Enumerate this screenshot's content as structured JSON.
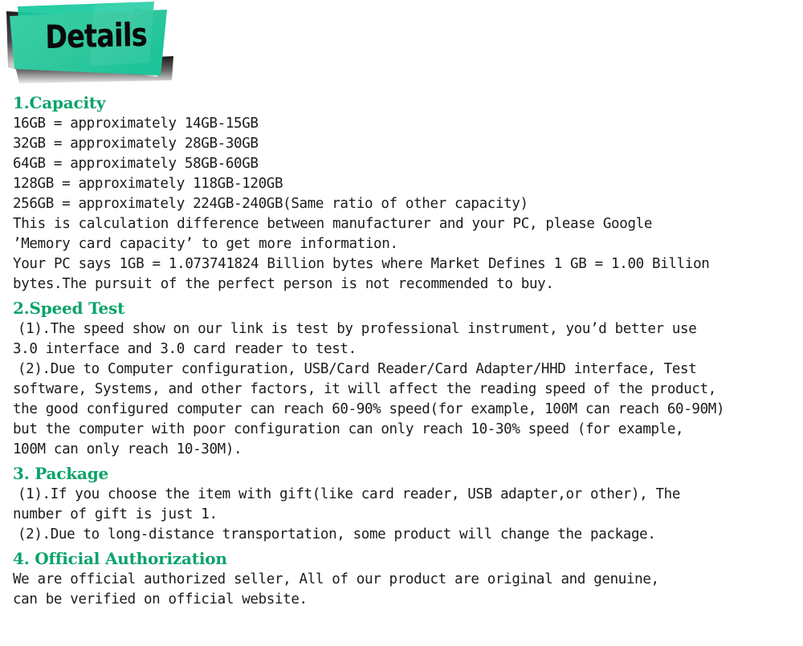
{
  "banner": {
    "title": "Details",
    "green": "#33cca3",
    "green_dark": "#14b894",
    "shadow_dark": "#111111",
    "text_color": "#0a0a0a"
  },
  "theme": {
    "heading_green": "#0aa36a",
    "body_text": "#1c1c1c",
    "page_background": "#ffffff"
  },
  "sections": [
    {
      "id": "capacity",
      "heading": "1.Capacity",
      "lines": [
        {
          "text": "16GB = approximately 14GB-15GB",
          "indent": false
        },
        {
          "text": "32GB = approximately 28GB-30GB",
          "indent": false
        },
        {
          "text": "64GB = approximately 58GB-60GB",
          "indent": false
        },
        {
          "text": "128GB = approximately 118GB-120GB",
          "indent": false
        },
        {
          "text": "256GB = approximately 224GB-240GB(Same ratio of other capacity)",
          "indent": false
        },
        {
          "text": "This is calculation difference between manufacturer and your PC, please Google",
          "indent": false
        },
        {
          "text": "’Memory card capacity’ to get more information.",
          "indent": false
        },
        {
          "text": "Your PC says 1GB = 1.073741824 Billion bytes where Market Defines 1 GB = 1.00 Billion",
          "indent": false
        },
        {
          "text": "bytes.The pursuit of the perfect person is not recommended to buy.",
          "indent": false
        }
      ]
    },
    {
      "id": "speed",
      "heading": "2.Speed Test",
      "lines": [
        {
          "text": "(1).The speed show on our link is test by professional instrument, you’d better use",
          "indent": true
        },
        {
          "text": "3.0 interface and 3.0 card reader to test.",
          "indent": false
        },
        {
          "text": "(2).Due to Computer configuration, USB/Card Reader/Card Adapter/HHD interface, Test",
          "indent": true
        },
        {
          "text": "software, Systems, and other factors, it will affect the reading speed of the product,",
          "indent": false
        },
        {
          "text": "the good configured computer can reach 60-90% speed(for example, 100M can reach 60-90M)",
          "indent": false
        },
        {
          "text": "but the computer with poor configuration can only reach 10-30% speed (for example,",
          "indent": false
        },
        {
          "text": "100M can only reach 10-30M).",
          "indent": false
        }
      ]
    },
    {
      "id": "package",
      "heading": "3. Package",
      "lines": [
        {
          "text": "(1).If you choose the item with gift(like card reader, USB adapter,or other), The",
          "indent": true
        },
        {
          "text": "number of gift is just 1.",
          "indent": false
        },
        {
          "text": "(2).Due to long-distance transportation, some product will change the package.",
          "indent": true
        }
      ]
    },
    {
      "id": "authorization",
      "heading": "4. Official Authorization",
      "lines": [
        {
          "text": "We are official authorized seller, All of our product are original and genuine,",
          "indent": false
        },
        {
          "text": "can be verified on official website.",
          "indent": false
        }
      ]
    }
  ]
}
